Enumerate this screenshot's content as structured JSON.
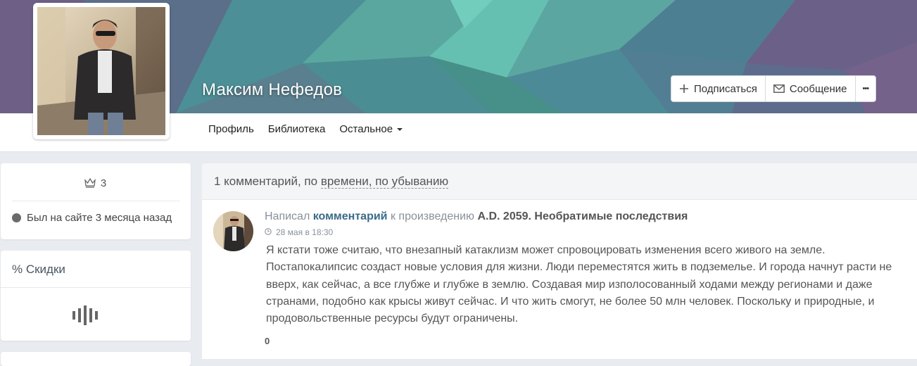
{
  "profile": {
    "name": "Максим Нефедов"
  },
  "actions": {
    "subscribe_label": "Подписаться",
    "message_label": "Сообщение",
    "more_label": "•••"
  },
  "nav": {
    "profile_label": "Профиль",
    "library_label": "Библиотека",
    "more_label": "Остальное"
  },
  "sidebar": {
    "rank_value": "3",
    "status_text": "Был на сайте 3 месяца назад",
    "discounts_title": "% Скидки"
  },
  "comments": {
    "count_text": "1 комментарий, по ",
    "sort_text": "времени, по убыванию",
    "item": {
      "prefix": "Написал ",
      "comment_link": "комментарий",
      "middle": " к произведению ",
      "work_title": "A.D. 2059. Необратимые последствия",
      "date": "28 мая в 18:30",
      "text": "Я кстати тоже считаю, что внезапный катаклизм может спровоцировать изменения всего живого на земле. Постапокалипсис создаст новые условия для жизни. Люди переместятся жить в подземелье. И города начнут расти не вверх, как сейчас, а все глубже и глубже в землю. Создавая мир изполосованный ходами между регионами и даже странами, подобно как крысы живут сейчас. И что жить смогут, не более 50 млн человек. Поскольку и природные, и продовольственные ресурсы будут ограничены.",
      "votes": "0"
    }
  },
  "colors": {
    "cover_teal": "#4f8a93",
    "cover_mint": "#68c3b3",
    "cover_purple": "#6f6289",
    "link": "#3b6a8a",
    "page_bg": "#e8ebf0"
  }
}
